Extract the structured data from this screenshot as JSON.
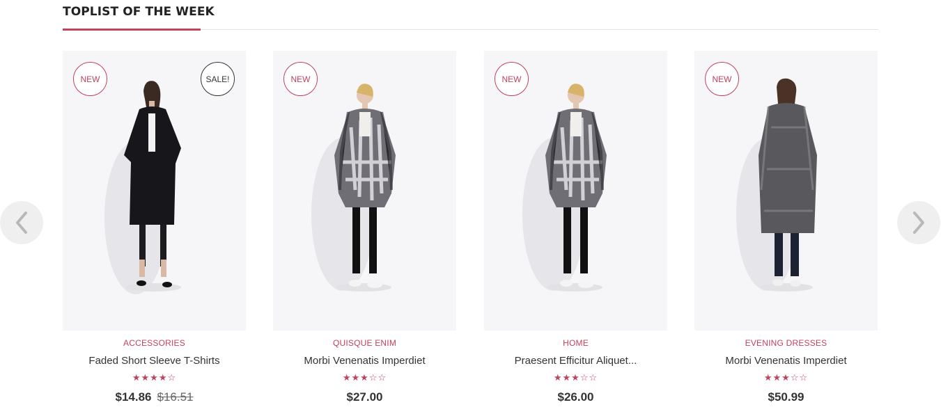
{
  "section": {
    "title": "TOPLIST OF THE WEEK"
  },
  "colors": {
    "accent": "#c2415c",
    "image_bg": "#f6f6f8",
    "text": "#333333"
  },
  "navigation": {
    "prev_icon": "chevron-left-icon",
    "next_icon": "chevron-right-icon"
  },
  "products": [
    {
      "category": "ACCESSORIES",
      "name": "Faded Short Sleeve T-Shirts",
      "rating": 4,
      "max_rating": 5,
      "price": "$14.86",
      "old_price": "$16.51",
      "badge_new": "NEW",
      "badge_sale": "SALE!",
      "image": "model-black-coat"
    },
    {
      "category": "QUISQUE ENIM",
      "name": "Morbi Venenatis Imperdiet",
      "rating": 3,
      "max_rating": 5,
      "price": "$27.00",
      "badge_new": "NEW",
      "image": "model-print-jacket"
    },
    {
      "category": "HOME",
      "name": "Praesent Efficitur Aliquet...",
      "rating": 3,
      "max_rating": 5,
      "price": "$26.00",
      "badge_new": "NEW",
      "image": "model-print-jacket"
    },
    {
      "category": "EVENING DRESSES",
      "name": "Morbi Venenatis Imperdiet",
      "rating": 3,
      "max_rating": 5,
      "price": "$50.99",
      "badge_new": "NEW",
      "image": "model-tweed-coat-back"
    }
  ]
}
